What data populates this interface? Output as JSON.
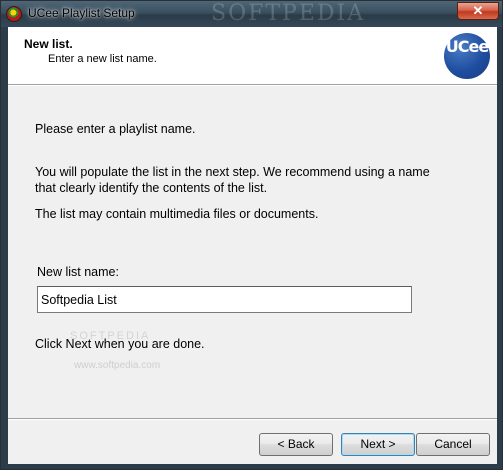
{
  "window": {
    "title": "UCee Playlist Setup",
    "watermark": "SOFTPEDIA",
    "close_glyph": "✕"
  },
  "header": {
    "title": "New list.",
    "subtitle": "Enter a new list name.",
    "logo_text": "UCee"
  },
  "body": {
    "line1": "Please enter a playlist name.",
    "line2a": "You will populate the list in the next step.  We recommend using a name",
    "line2b": "that clearly identify the contents of the list.",
    "line3": "The list may contain multimedia files or documents.",
    "field_label": "New list name:",
    "field_value": "Softpedia List",
    "watermark_small": "SOFTPEDIA",
    "watermark_url": "www.softpedia.com",
    "line4": "Click Next when you are done."
  },
  "buttons": {
    "back": "< Back",
    "next": "Next >",
    "cancel": "Cancel"
  },
  "colors": {
    "accent": "#3c7fb1",
    "close": "#c1391e",
    "logo": "#1f4ea0"
  },
  "icons": {
    "app": "ucee-app-icon",
    "close": "close-icon",
    "logo": "ucee-logo-icon"
  }
}
